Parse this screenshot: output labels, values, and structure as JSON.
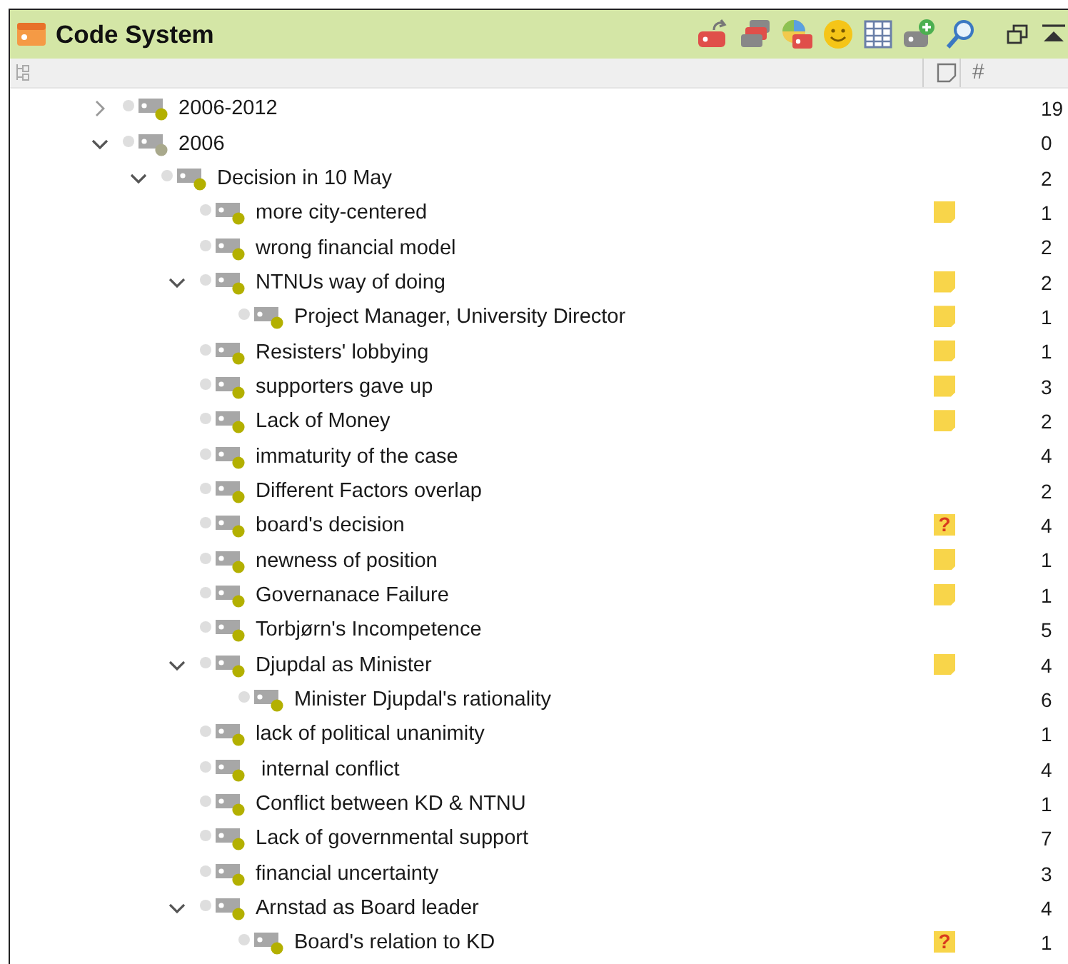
{
  "panel": {
    "title": "Code System"
  },
  "columns": {
    "count_header": "#"
  },
  "codes": [
    {
      "label": "2006-2012",
      "count": "19",
      "color": "#b3b000",
      "expanded": false
    },
    {
      "label": "2006",
      "count": "0",
      "color": "#a9a98c",
      "expanded": true,
      "children": [
        {
          "label": "Decision in 10 May",
          "count": "2",
          "color": "#b3b000",
          "expanded": true,
          "children": [
            {
              "label": "more city-centered",
              "count": "1",
              "color": "#b3b000",
              "memo": {
                "kind": "note"
              }
            },
            {
              "label": "wrong financial model",
              "count": "2",
              "color": "#b3b000"
            },
            {
              "label": "NTNUs way of doing",
              "count": "2",
              "color": "#b3b000",
              "memo": {
                "kind": "note"
              },
              "expanded": true,
              "children": [
                {
                  "label": "Project Manager, University Director",
                  "count": "1",
                  "color": "#b3b000",
                  "memo": {
                    "kind": "note"
                  }
                }
              ]
            },
            {
              "label": "Resisters' lobbying",
              "count": "1",
              "color": "#b3b000",
              "memo": {
                "kind": "note"
              }
            },
            {
              "label": "supporters gave up",
              "count": "3",
              "color": "#b3b000",
              "memo": {
                "kind": "note"
              }
            },
            {
              "label": "Lack of Money",
              "count": "2",
              "color": "#b3b000",
              "memo": {
                "kind": "note"
              }
            },
            {
              "label": "immaturity of the case",
              "count": "4",
              "color": "#b3b000"
            },
            {
              "label": "Different Factors overlap",
              "count": "2",
              "color": "#b3b000"
            },
            {
              "label": "board's decision",
              "count": "4",
              "color": "#b3b000",
              "memo": {
                "kind": "question",
                "symbol": "?"
              }
            },
            {
              "label": "newness of position",
              "count": "1",
              "color": "#b3b000",
              "memo": {
                "kind": "note"
              }
            },
            {
              "label": "Governanace Failure",
              "count": "1",
              "color": "#b3b000",
              "memo": {
                "kind": "note"
              }
            },
            {
              "label": "Torbjørn's Incompetence",
              "count": "5",
              "color": "#b3b000"
            },
            {
              "label": "Djupdal as Minister",
              "count": "4",
              "color": "#b3b000",
              "memo": {
                "kind": "note"
              },
              "expanded": true,
              "children": [
                {
                  "label": "Minister Djupdal's rationality",
                  "count": "6",
                  "color": "#b3b000"
                }
              ]
            },
            {
              "label": "lack of political unanimity",
              "count": "1",
              "color": "#b3b000"
            },
            {
              "label": " internal conflict",
              "count": "4",
              "color": "#b3b000"
            },
            {
              "label": "Conflict between KD & NTNU",
              "count": "1",
              "color": "#b3b000"
            },
            {
              "label": "Lack of governmental support",
              "count": "7",
              "color": "#b3b000"
            },
            {
              "label": "financial uncertainty",
              "count": "3",
              "color": "#b3b000"
            },
            {
              "label": "Arnstad as Board leader",
              "count": "4",
              "color": "#b3b000",
              "expanded": true,
              "children": [
                {
                  "label": "Board's relation to KD",
                  "count": "1",
                  "color": "#b3b000",
                  "memo": {
                    "kind": "question",
                    "symbol": "?"
                  }
                }
              ]
            }
          ]
        }
      ]
    }
  ]
}
